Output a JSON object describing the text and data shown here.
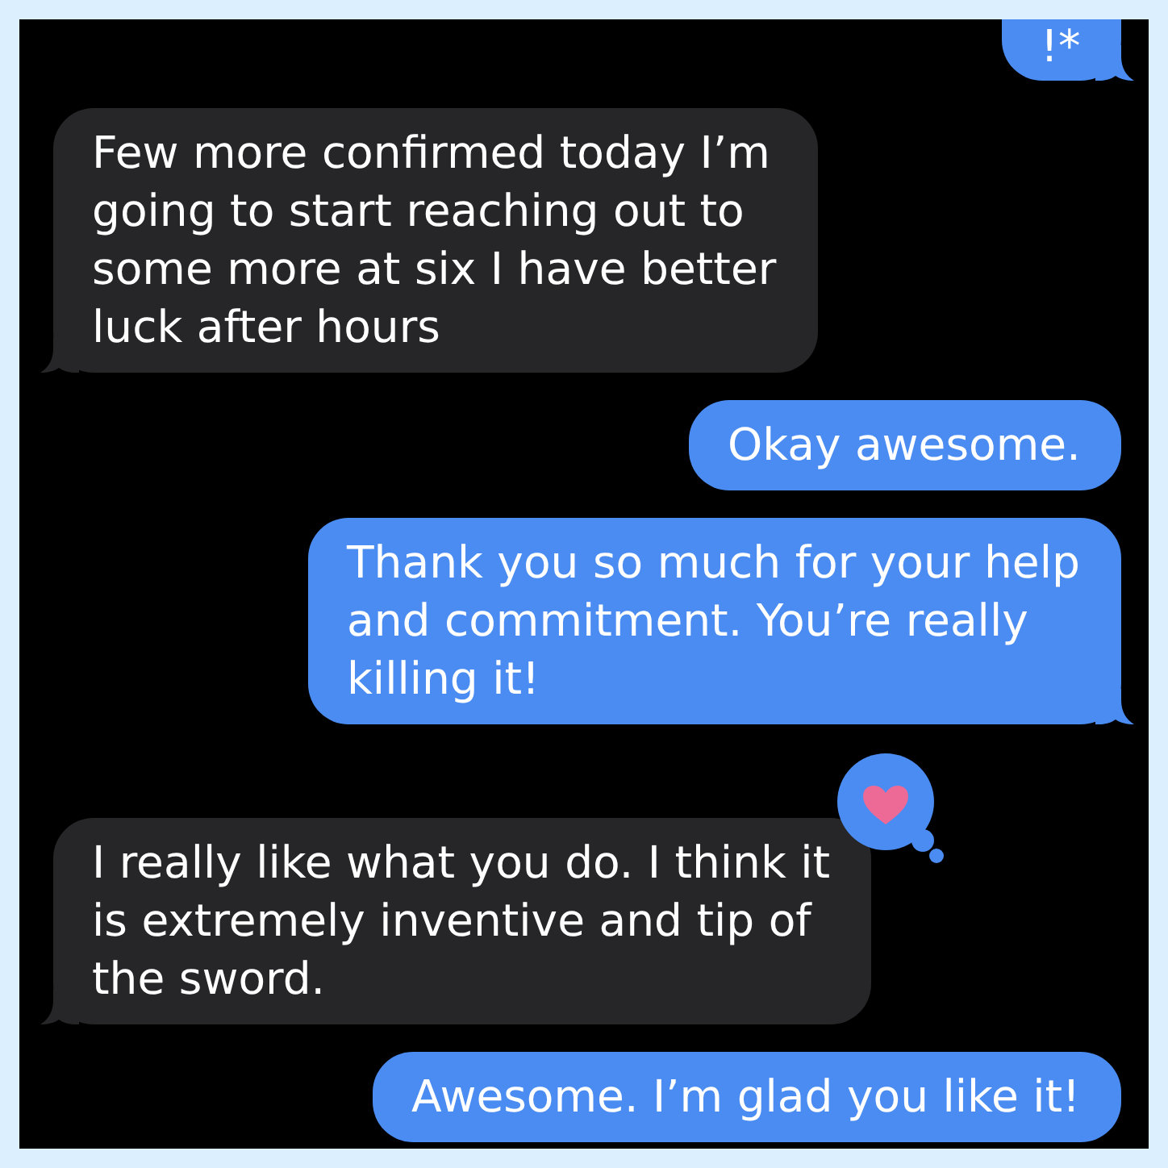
{
  "messages": [
    {
      "kind": "sent",
      "text": "!*",
      "tail": true,
      "hearted": false
    },
    {
      "kind": "received",
      "text": "Few more confirmed today I’m going to start reaching out to some more at six I have better luck after hours",
      "tail": true,
      "hearted": false
    },
    {
      "kind": "sent",
      "text": "Okay awesome.",
      "tail": false,
      "hearted": false
    },
    {
      "kind": "sent",
      "text": "Thank you so much for your help and commitment. You’re really killing it!",
      "tail": true,
      "hearted": false
    },
    {
      "kind": "received",
      "text": "I really like what you do. I think it is extremely inventive and tip of the sword.",
      "tail": true,
      "hearted": true
    },
    {
      "kind": "sent",
      "text": "Awesome. I’m glad you like it!",
      "tail": false,
      "hearted": false
    }
  ]
}
